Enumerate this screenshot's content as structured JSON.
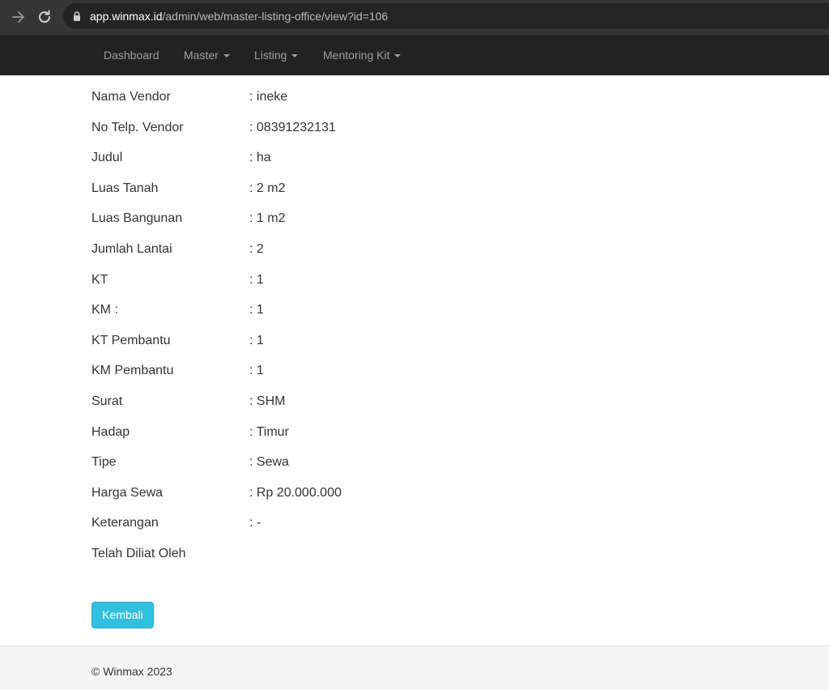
{
  "browser": {
    "url_host": "app.winmax.id",
    "url_path": "/admin/web/master-listing-office/view?id=106"
  },
  "navbar": {
    "items": [
      {
        "label": "Dashboard",
        "dropdown": false
      },
      {
        "label": "Master",
        "dropdown": true
      },
      {
        "label": "Listing",
        "dropdown": true
      },
      {
        "label": "Mentoring Kit",
        "dropdown": true
      }
    ]
  },
  "details": [
    {
      "label": "Nama Vendor",
      "value": ": ineke"
    },
    {
      "label": "No Telp. Vendor",
      "value": ": 08391232131"
    },
    {
      "label": "Judul",
      "value": ": ha"
    },
    {
      "label": "Luas Tanah",
      "value": ": 2 m2"
    },
    {
      "label": "Luas Bangunan",
      "value": ": 1 m2"
    },
    {
      "label": "Jumlah Lantai",
      "value": ": 2"
    },
    {
      "label": "KT",
      "value": ": 1"
    },
    {
      "label": "KM :",
      "value": ": 1"
    },
    {
      "label": "KT Pembantu",
      "value": ": 1"
    },
    {
      "label": "KM Pembantu",
      "value": ": 1"
    },
    {
      "label": "Surat",
      "value": ": SHM"
    },
    {
      "label": "Hadap",
      "value": ": Timur"
    },
    {
      "label": "Tipe",
      "value": ": Sewa"
    },
    {
      "label": "Harga Sewa",
      "value": ": Rp 20.000.000"
    },
    {
      "label": "Keterangan",
      "value": ": -"
    },
    {
      "label": "Telah Diliat Oleh",
      "value": ""
    }
  ],
  "actions": {
    "back_label": "Kembali",
    "back_color": "#31c0e0"
  },
  "footer": {
    "text": "© Winmax 2023"
  },
  "icons": {
    "forward": "arrow-right-icon",
    "reload": "reload-icon",
    "lock": "lock-icon"
  }
}
